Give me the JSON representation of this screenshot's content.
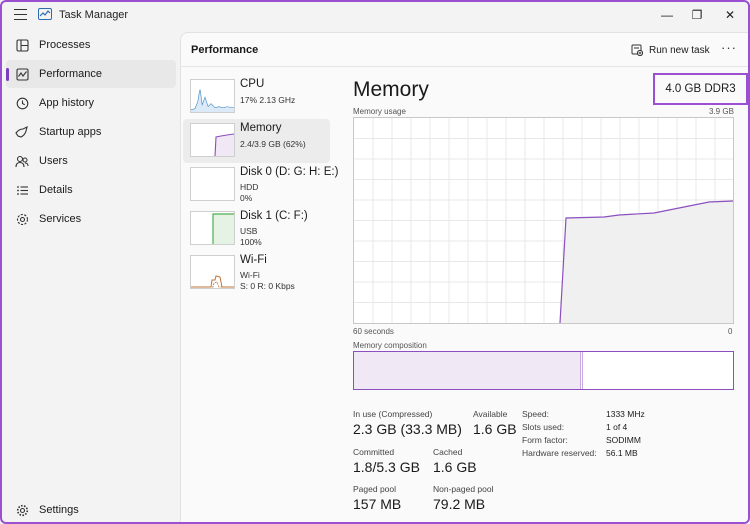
{
  "titlebar": {
    "app_title": "Task Manager",
    "minimize_glyph": "—",
    "maximize_glyph": "❐",
    "close_glyph": "✕"
  },
  "sidebar": {
    "items": [
      {
        "label": "Processes",
        "icon": "processes-icon"
      },
      {
        "label": "Performance",
        "icon": "performance-icon"
      },
      {
        "label": "App history",
        "icon": "app-history-icon"
      },
      {
        "label": "Startup apps",
        "icon": "startup-apps-icon"
      },
      {
        "label": "Users",
        "icon": "users-icon"
      },
      {
        "label": "Details",
        "icon": "details-icon"
      },
      {
        "label": "Services",
        "icon": "services-icon"
      }
    ],
    "settings_label": "Settings"
  },
  "header": {
    "title": "Performance",
    "run_new_task_label": "Run new task",
    "more_glyph": "···"
  },
  "devices": [
    {
      "name": "CPU",
      "line1": "17%  2.13 GHz",
      "line2": ""
    },
    {
      "name": "Memory",
      "line1": "2.4/3.9 GB (62%)",
      "line2": ""
    },
    {
      "name": "Disk 0 (D: G: H: E:)",
      "line1": "HDD",
      "line2": "0%"
    },
    {
      "name": "Disk 1 (C: F:)",
      "line1": "USB",
      "line2": "100%"
    },
    {
      "name": "Wi-Fi",
      "line1": "Wi-Fi",
      "line2": "S: 0  R: 0 Kbps"
    }
  ],
  "detail": {
    "title": "Memory",
    "spec": "4.0 GB DDR3",
    "usage_label": "Memory usage",
    "usage_max": "3.9 GB",
    "time_left": "60 seconds",
    "time_right": "0",
    "composition_label": "Memory composition",
    "composition_in_use_fraction": 0.6
  },
  "stats": {
    "in_use_label": "In use (Compressed)",
    "in_use_value": "2.3 GB (33.3 MB)",
    "available_label": "Available",
    "available_value": "1.6 GB",
    "committed_label": "Committed",
    "committed_value": "1.8/5.3 GB",
    "cached_label": "Cached",
    "cached_value": "1.6 GB",
    "paged_label": "Paged pool",
    "paged_value": "157 MB",
    "nonpaged_label": "Non-paged pool",
    "nonpaged_value": "79.2 MB"
  },
  "specs": [
    {
      "key": "Speed:",
      "value": "1333 MHz"
    },
    {
      "key": "Slots used:",
      "value": "1 of 4"
    },
    {
      "key": "Form factor:",
      "value": "SODIMM"
    },
    {
      "key": "Hardware reserved:",
      "value": "56.1 MB"
    }
  ],
  "colors": {
    "accent": "#9b4fd1",
    "memory_line": "#8b4fbf",
    "memory_fill": "#f0e8f5",
    "disk_green": "#4caf50",
    "wifi_orange": "#c0753a",
    "cpu_blue": "#2f7fc0"
  }
}
